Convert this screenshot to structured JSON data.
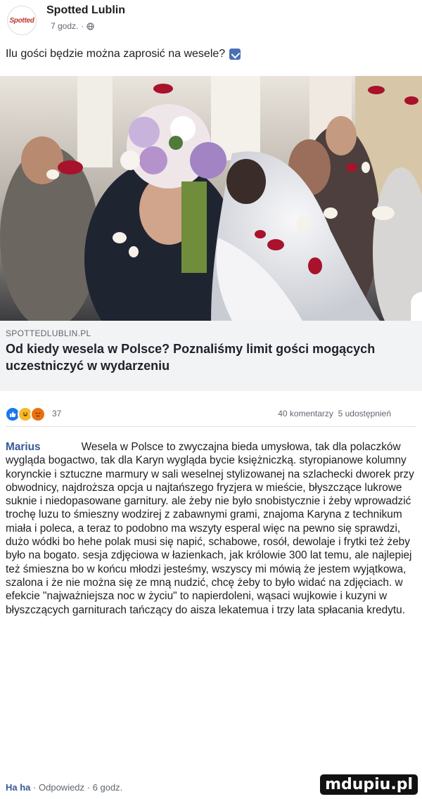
{
  "post": {
    "page_name": "Spotted Lublin",
    "avatar_text": "Spotted",
    "time": "7 godz.",
    "meta_separator": "·",
    "text": "Ilu gości będzie można zaprosić na wesele?",
    "icon": "globe-icon"
  },
  "link": {
    "domain": "SPOTTEDLUBLIN.PL",
    "title": "Od kiedy wesela w Polsce? Poznaliśmy limit gości mogących uczestniczyć w wydarzeniu",
    "image_alt": "Bride and groom kissing with a bouquet among guests throwing rose petals"
  },
  "reactions": {
    "icons": [
      "like-icon",
      "haha-icon",
      "angry-icon"
    ],
    "count": "37",
    "comments": "40 komentarzy",
    "shares": "5 udostępnień"
  },
  "comment": {
    "author": "Marius",
    "text": "Wesela w Polsce to zwyczajna bieda umysłowa, tak dla polaczków wygląda bogactwo, tak dla Karyn wygląda bycie księżniczką. styropianowe kolumny korynckie i sztuczne marmury w sali weselnej stylizowanej na szlachecki dworek przy obwodnicy, najdroższa opcja u najtańszego fryzjera w mieście, błyszczące lukrowe suknie i niedopasowane garnitury. ale żeby nie było snobistycznie i żeby wprowadzić trochę luzu to śmieszny wodzirej z zabawnymi grami, znajoma Karyna z technikum miała i poleca, a teraz to podobno ma wszyty esperal więc na pewno się sprawdzi, dużo wódki bo hehe polak musi się napić, schabowe, rosół, dewolaje i frytki też żeby było na bogato. sesja zdjęciowa w łazienkach, jak królowie 300 lat temu, ale najlepiej też śmieszna bo w końcu młodzi jesteśmy, wszyscy mi mówią że jestem wyjątkowa, szalona i że nie można się ze mną nudzić, chcę żeby to było widać na zdjęciach. w efekcie \"najważniejsza noc w życiu\" to napierdoleni, wąsaci wujkowie i kuzyni w błyszczących garniturach tańczący do aisza lekatemua i trzy lata spłacania kredytu.",
    "reaction_label": "Ha ha",
    "separator1": "·",
    "reply_label": "Odpowiedz",
    "separator2": "·",
    "time": "6 godz."
  },
  "watermark": "mdupiu.pl",
  "colors": {
    "link_blue": "#385898",
    "like_blue": "#1877f2",
    "caption_bg": "#f2f3f5"
  }
}
